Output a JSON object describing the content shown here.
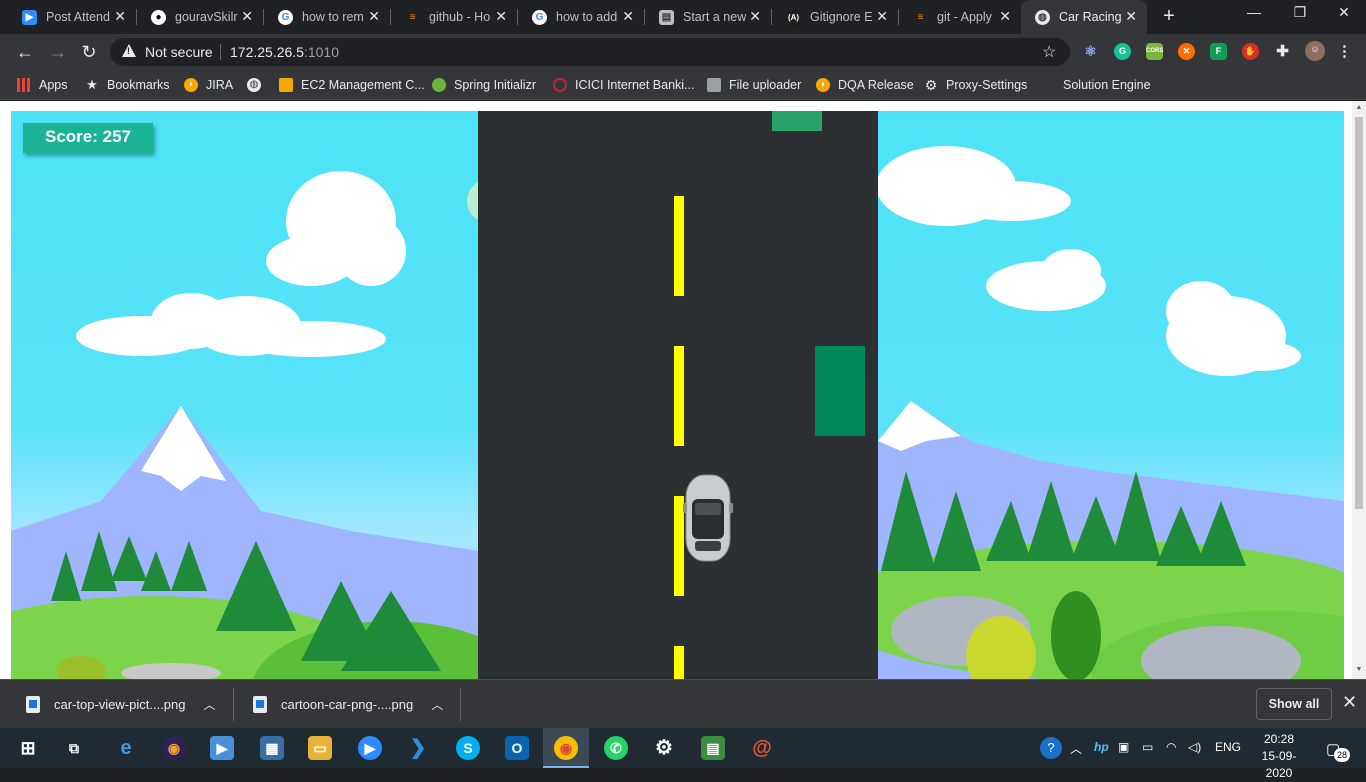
{
  "browser": {
    "tabs": [
      {
        "title": "Post Attend",
        "icon": "zoom-icon",
        "color": "#2d8cff"
      },
      {
        "title": "gouravSkilr",
        "icon": "github-icon",
        "color": "#ffffff"
      },
      {
        "title": "how to rem",
        "icon": "google-icon",
        "color": "#ffffff"
      },
      {
        "title": "github - Ho",
        "icon": "stackoverflow-icon",
        "color": "#f48024"
      },
      {
        "title": "how to add",
        "icon": "google-icon",
        "color": "#ffffff"
      },
      {
        "title": "Start a new",
        "icon": "page-icon",
        "color": "#bdc1c6"
      },
      {
        "title": "Gitignore E",
        "icon": "angular-icon",
        "color": "#1e1e1e"
      },
      {
        "title": "git - Apply",
        "icon": "stackoverflow-icon",
        "color": "#f48024"
      },
      {
        "title": "Car Racing",
        "icon": "globe-icon",
        "color": "#e8eaed",
        "active": true
      }
    ],
    "security_label": "Not secure",
    "url_host": "172.25.26.5",
    "url_port": ":1010",
    "bookmarks": [
      {
        "label": "Apps",
        "icon": "apps-grid-icon"
      },
      {
        "label": "Bookmarks",
        "icon": "star-icon"
      },
      {
        "label": "JIRA",
        "icon": "jira-icon"
      },
      {
        "label": "",
        "icon": "globe-icon"
      },
      {
        "label": "EC2 Management C...",
        "icon": "aws-icon"
      },
      {
        "label": "Spring Initializr",
        "icon": "spring-icon"
      },
      {
        "label": "ICICI  Internet Banki...",
        "icon": "icici-icon"
      },
      {
        "label": "File uploader",
        "icon": "file-icon"
      },
      {
        "label": "DQA Release",
        "icon": "jira-icon"
      },
      {
        "label": "Proxy-Settings",
        "icon": "gear-icon"
      },
      {
        "label": "Solution Engine",
        "icon": "blank-icon"
      }
    ]
  },
  "game": {
    "score_label": "Score: 257",
    "colors": {
      "road": "#2d3033",
      "lane": "#ffff00",
      "enemy": "#00875a",
      "score_bg": "#1ab394"
    }
  },
  "downloads": {
    "items": [
      {
        "name": "car-top-view-pict....png"
      },
      {
        "name": "cartoon-car-png-....png"
      }
    ],
    "show_all_label": "Show all"
  },
  "taskbar": {
    "language": "ENG",
    "time": "20:28",
    "date": "15-09-2020",
    "notification_count": "28"
  }
}
